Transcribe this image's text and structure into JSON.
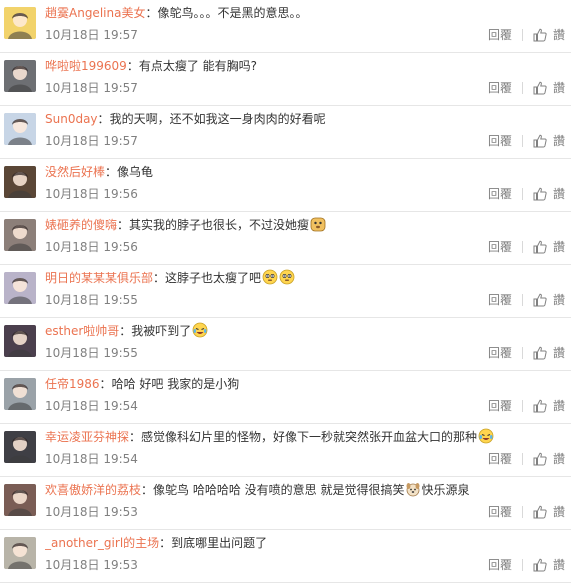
{
  "comments": [
    {
      "user": "趙霙Angelina美女",
      "colon": "：",
      "text": "像鸵鸟。。。不是黑的意思。。",
      "emojis": [],
      "time": "10月18日 19:57",
      "reply": "回覆",
      "like": "讚",
      "avatar_color": "#f2d36b"
    },
    {
      "user": "哗啦啦199609",
      "colon": "：",
      "text": "有点太瘦了 能有胸吗?",
      "emojis": [],
      "time": "10月18日 19:57",
      "reply": "回覆",
      "like": "讚",
      "avatar_color": "#6d6f73"
    },
    {
      "user": "Sun0day",
      "colon": "：",
      "text": "我的天啊，还不如我这一身肉肉的好看呢",
      "emojis": [],
      "time": "10月18日 19:57",
      "reply": "回覆",
      "like": "讚",
      "avatar_color": "#c7d5e6"
    },
    {
      "user": "没然后好棒",
      "colon": "：",
      "text": "像乌龟",
      "emojis": [],
      "time": "10月18日 19:56",
      "reply": "回覆",
      "like": "讚",
      "avatar_color": "#5a4636"
    },
    {
      "user": "婊砸养的傻嗨",
      "colon": "：",
      "text": "其实我的脖子也很长，不过没她瘦",
      "emojis": [
        "doge-emoji"
      ],
      "time": "10月18日 19:56",
      "reply": "回覆",
      "like": "讚",
      "avatar_color": "#8c7f79"
    },
    {
      "user": "明日的某某某俱乐部",
      "colon": "：",
      "text": "这脖子也太瘦了吧",
      "emojis": [
        "cold-sweat-emoji",
        "cold-sweat-emoji"
      ],
      "time": "10月18日 19:55",
      "reply": "回覆",
      "like": "讚",
      "avatar_color": "#b9b3c9"
    },
    {
      "user": "esther啦帅哥",
      "colon": "：",
      "text": "我被吓到了",
      "emojis": [
        "laugh-cry-emoji"
      ],
      "time": "10月18日 19:55",
      "reply": "回覆",
      "like": "讚",
      "avatar_color": "#4b3f4d"
    },
    {
      "user": "任帝1986",
      "colon": "：",
      "text": "哈哈 好吧 我家的是小狗",
      "emojis": [],
      "time": "10月18日 19:54",
      "reply": "回覆",
      "like": "讚",
      "avatar_color": "#9aa2a8"
    },
    {
      "user": "幸运凌亚芬神探",
      "colon": "：",
      "text": "感觉像科幻片里的怪物，好像下一秒就突然张开血盆大口的那种",
      "emojis": [
        "laugh-cry-emoji"
      ],
      "time": "10月18日 19:54",
      "reply": "回覆",
      "like": "讚",
      "avatar_color": "#3f3f45"
    },
    {
      "user": "欢喜傲娇洋的荔枝",
      "colon": "：",
      "text": "像鸵鸟 哈哈哈哈 没有喷的意思 就是觉得很搞笑",
      "emojis": [
        "dog-emoji"
      ],
      "text_after": "快乐源泉",
      "time": "10月18日 19:53",
      "reply": "回覆",
      "like": "讚",
      "avatar_color": "#7a5d55"
    },
    {
      "user": "_another_girl的主场",
      "colon": "：",
      "text": "到底哪里出问题了",
      "emojis": [],
      "time": "10月18日 19:53",
      "reply": "回覆",
      "like": "讚",
      "avatar_color": "#b8b4a8"
    }
  ]
}
